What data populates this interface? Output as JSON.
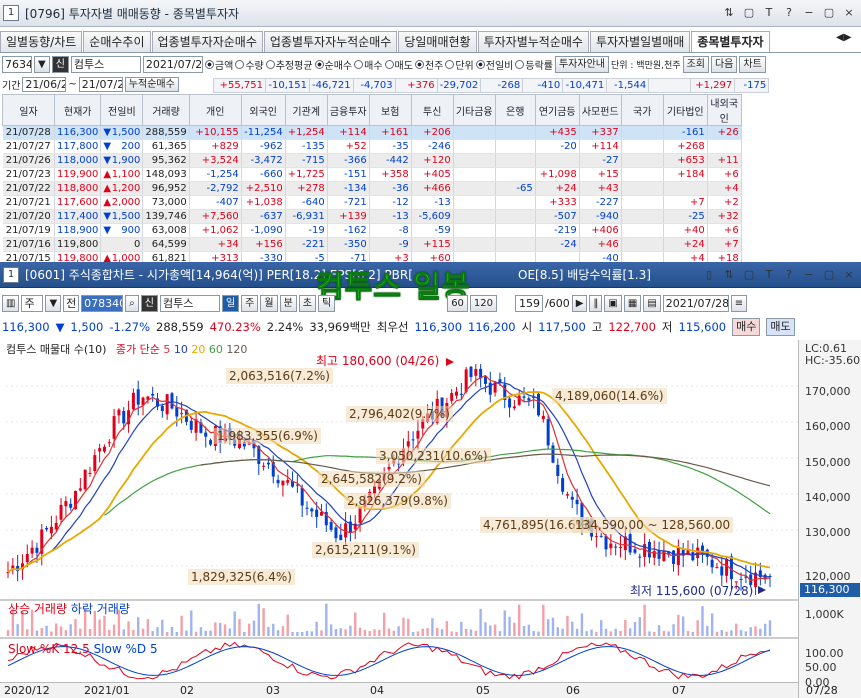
{
  "window1": {
    "num": "1",
    "title": "[0796] 투자자별 매매동향 - 종목별투자자",
    "ctrls": [
      "⇅",
      "▢",
      "T",
      "?",
      "−",
      "▢",
      "×"
    ]
  },
  "tabs": [
    "일별동향/차트",
    "순매수추이",
    "업종별투자자순매수",
    "업종별투자자누적순매수",
    "당일매매현황",
    "투자자별누적순매수",
    "투자자별일별매매",
    "종목별투자자"
  ],
  "tabs_more": "◀▶",
  "controls1": {
    "code": "76340",
    "code_btn": "▼",
    "badge": "신",
    "name": "컴투스",
    "date": "2021/07/2",
    "radios": [
      "금액",
      "수량",
      "추정평균"
    ],
    "radios2": [
      "순매수",
      "매수",
      "매도"
    ],
    "radios3": [
      "천주",
      "단위"
    ],
    "radios4": [
      "전일비",
      "등락률"
    ],
    "btn_investor": "투자자안내",
    "unit": "단위 : 백만원,천주",
    "btn_search": "조회",
    "btn_next": "다음",
    "btn_chart": "차트"
  },
  "controls2": {
    "period_label": "기간",
    "from": "21/06/2",
    "to": "21/07/2",
    "total_label": "누적순매수"
  },
  "sum_row": [
    "",
    "",
    "",
    "",
    "+55,751",
    "-10,151",
    "-46,721",
    "-4,703",
    "+376",
    "-29,702",
    "-268",
    "-410",
    "-10,471",
    "-1,544",
    "",
    "+1,297",
    "-175"
  ],
  "columns": [
    "일자",
    "현재가",
    "전일비",
    "거래량",
    "개인",
    "외국인",
    "기관계",
    "금융투자",
    "보험",
    "투신",
    "기타금융",
    "은행",
    "연기금등",
    "사모펀드",
    "국가",
    "기타법인",
    "내외국인"
  ],
  "rows": [
    [
      "21/07/28",
      "116,300",
      "d",
      "1,500",
      "288,559",
      "+10,155",
      "-11,254",
      "+1,254",
      "+114",
      "+161",
      "+206",
      "",
      "",
      "+435",
      "+337",
      "",
      "-161",
      "+26"
    ],
    [
      "21/07/27",
      "117,800",
      "d",
      "200",
      "61,365",
      "+829",
      "-962",
      "-135",
      "+52",
      "-35",
      "-246",
      "",
      "",
      "-20",
      "+114",
      "",
      "+268",
      ""
    ],
    [
      "21/07/26",
      "118,000",
      "d",
      "1,900",
      "95,362",
      "+3,524",
      "-3,472",
      "-715",
      "-366",
      "-442",
      "+120",
      "",
      "",
      "",
      "-27",
      "",
      "+653",
      "+11"
    ],
    [
      "21/07/23",
      "119,900",
      "u",
      "1,100",
      "148,093",
      "-1,254",
      "-660",
      "+1,725",
      "-151",
      "+358",
      "+405",
      "",
      "",
      "+1,098",
      "+15",
      "",
      "+184",
      "+6"
    ],
    [
      "21/07/22",
      "118,800",
      "u",
      "1,200",
      "96,952",
      "-2,792",
      "+2,510",
      "+278",
      "-134",
      "-36",
      "+466",
      "",
      "-65",
      "+24",
      "+43",
      "",
      "",
      "+4"
    ],
    [
      "21/07/21",
      "117,600",
      "u",
      "2,000",
      "73,000",
      "-407",
      "+1,038",
      "-640",
      "-721",
      "-12",
      "-13",
      "",
      "",
      "+333",
      "-227",
      "",
      "+7",
      "+2"
    ],
    [
      "21/07/20",
      "117,400",
      "d",
      "1,500",
      "139,746",
      "+7,560",
      "-637",
      "-6,931",
      "+139",
      "-13",
      "-5,609",
      "",
      "",
      "-507",
      "-940",
      "",
      "-25",
      "+32"
    ],
    [
      "21/07/19",
      "118,900",
      "d",
      "900",
      "63,008",
      "+1,062",
      "-1,090",
      "-19",
      "-162",
      "-8",
      "-59",
      "",
      "",
      "-219",
      "+406",
      "",
      "+40",
      "+6"
    ],
    [
      "21/07/16",
      "119,800",
      "",
      "0",
      "64,599",
      "+34",
      "+156",
      "-221",
      "-350",
      "-9",
      "+115",
      "",
      "",
      "-24",
      "+46",
      "",
      "+24",
      "+7"
    ],
    [
      "21/07/15",
      "119,800",
      "u",
      "1,000",
      "61,821",
      "+313",
      "-330",
      "-5",
      "-71",
      "+3",
      "+60",
      "",
      "",
      "",
      "-40",
      "",
      "+4",
      "+18"
    ]
  ],
  "window2": {
    "num": "1",
    "title": "[0601] 주식종합차트 - 시가총액[14,964(억)] PER[18.2] EPS[6,2] PBR[",
    "title2": "OE[8.5] 배당수익률[1.3]",
    "ctrls": [
      "▯",
      "⇅",
      "▢",
      "T",
      "?",
      "−",
      "▢",
      "×"
    ]
  },
  "toolbar2": {
    "kind": "주",
    "jeon": "전",
    "code": "078340",
    "badge": "신",
    "name": "컴투스",
    "periods": [
      "일",
      "주",
      "월",
      "분",
      "초",
      "틱"
    ],
    "ma": [
      "60",
      "120"
    ],
    "count": "159",
    "total": "/600",
    "date": "2021/07/28"
  },
  "quote": {
    "price": "116,300",
    "change": "1,500",
    "pct": "-1.27%",
    "volume": "288,559",
    "vol_ratio": "470.23%",
    "turnover": "2.24%",
    "amount": "33,969백만",
    "pref_label": "최우선",
    "bid": "116,300",
    "ask": "116,200",
    "open_label": "시",
    "open": "117,500",
    "high_label": "고",
    "high": "122,700",
    "low_label": "저",
    "low": "115,600",
    "btn_buy": "매수",
    "btn_sell": "매도"
  },
  "overlay": "컴투스 일봉",
  "main_legend": {
    "title": "컴투스 매물대 수(10)",
    "ma_title": "종가 단순",
    "ma": [
      "5",
      "10",
      "20",
      "60",
      "120"
    ]
  },
  "right_hud": {
    "lc": "LC:0.61",
    "hc": "HC:-35.60"
  },
  "y_ticks": [
    "170,000",
    "160,000",
    "150,000",
    "140,000",
    "130,000",
    "120,000"
  ],
  "price_tag": "116,300",
  "annotations": {
    "high": "최고 180,600 (04/26)",
    "low": "최저 115,600 (07/28)",
    "vp": [
      "2,063,516(7.2%)",
      "1,983,355(6.9%)",
      "2,796,402(9.7%)",
      "4,189,060(14.6%)",
      "3,050,231(10.6%)",
      "2,645,582(9.2%)",
      "2,826,379(9.8%)",
      "4,761,895(16.6%)",
      "2,615,211(9.1%)",
      "1,829,325(6.4%)"
    ],
    "range": "134,590.00 ~ 128,560.00"
  },
  "vol_legend": {
    "up": "상승 거래량",
    "down": "하락 거래량",
    "tick": "1,000K"
  },
  "stoch_legend": {
    "k": "Slow %K 12,5",
    "d": "Slow %D 5",
    "ticks": [
      "100.00",
      "50.00",
      "0.00"
    ]
  },
  "x_labels": [
    "2020/12",
    "2021/01",
    "02",
    "03",
    "04",
    "05",
    "06",
    "07",
    "07/28"
  ],
  "colors": {
    "up": "#e0001a",
    "down": "#0040d0",
    "ma5": "#e03030",
    "ma10": "#2040c0",
    "ma20": "#e8a800",
    "ma60": "#40a040",
    "ma120": "#6a5a4a",
    "overlay": "#2fe236",
    "vp": "#f0d8b4"
  }
}
